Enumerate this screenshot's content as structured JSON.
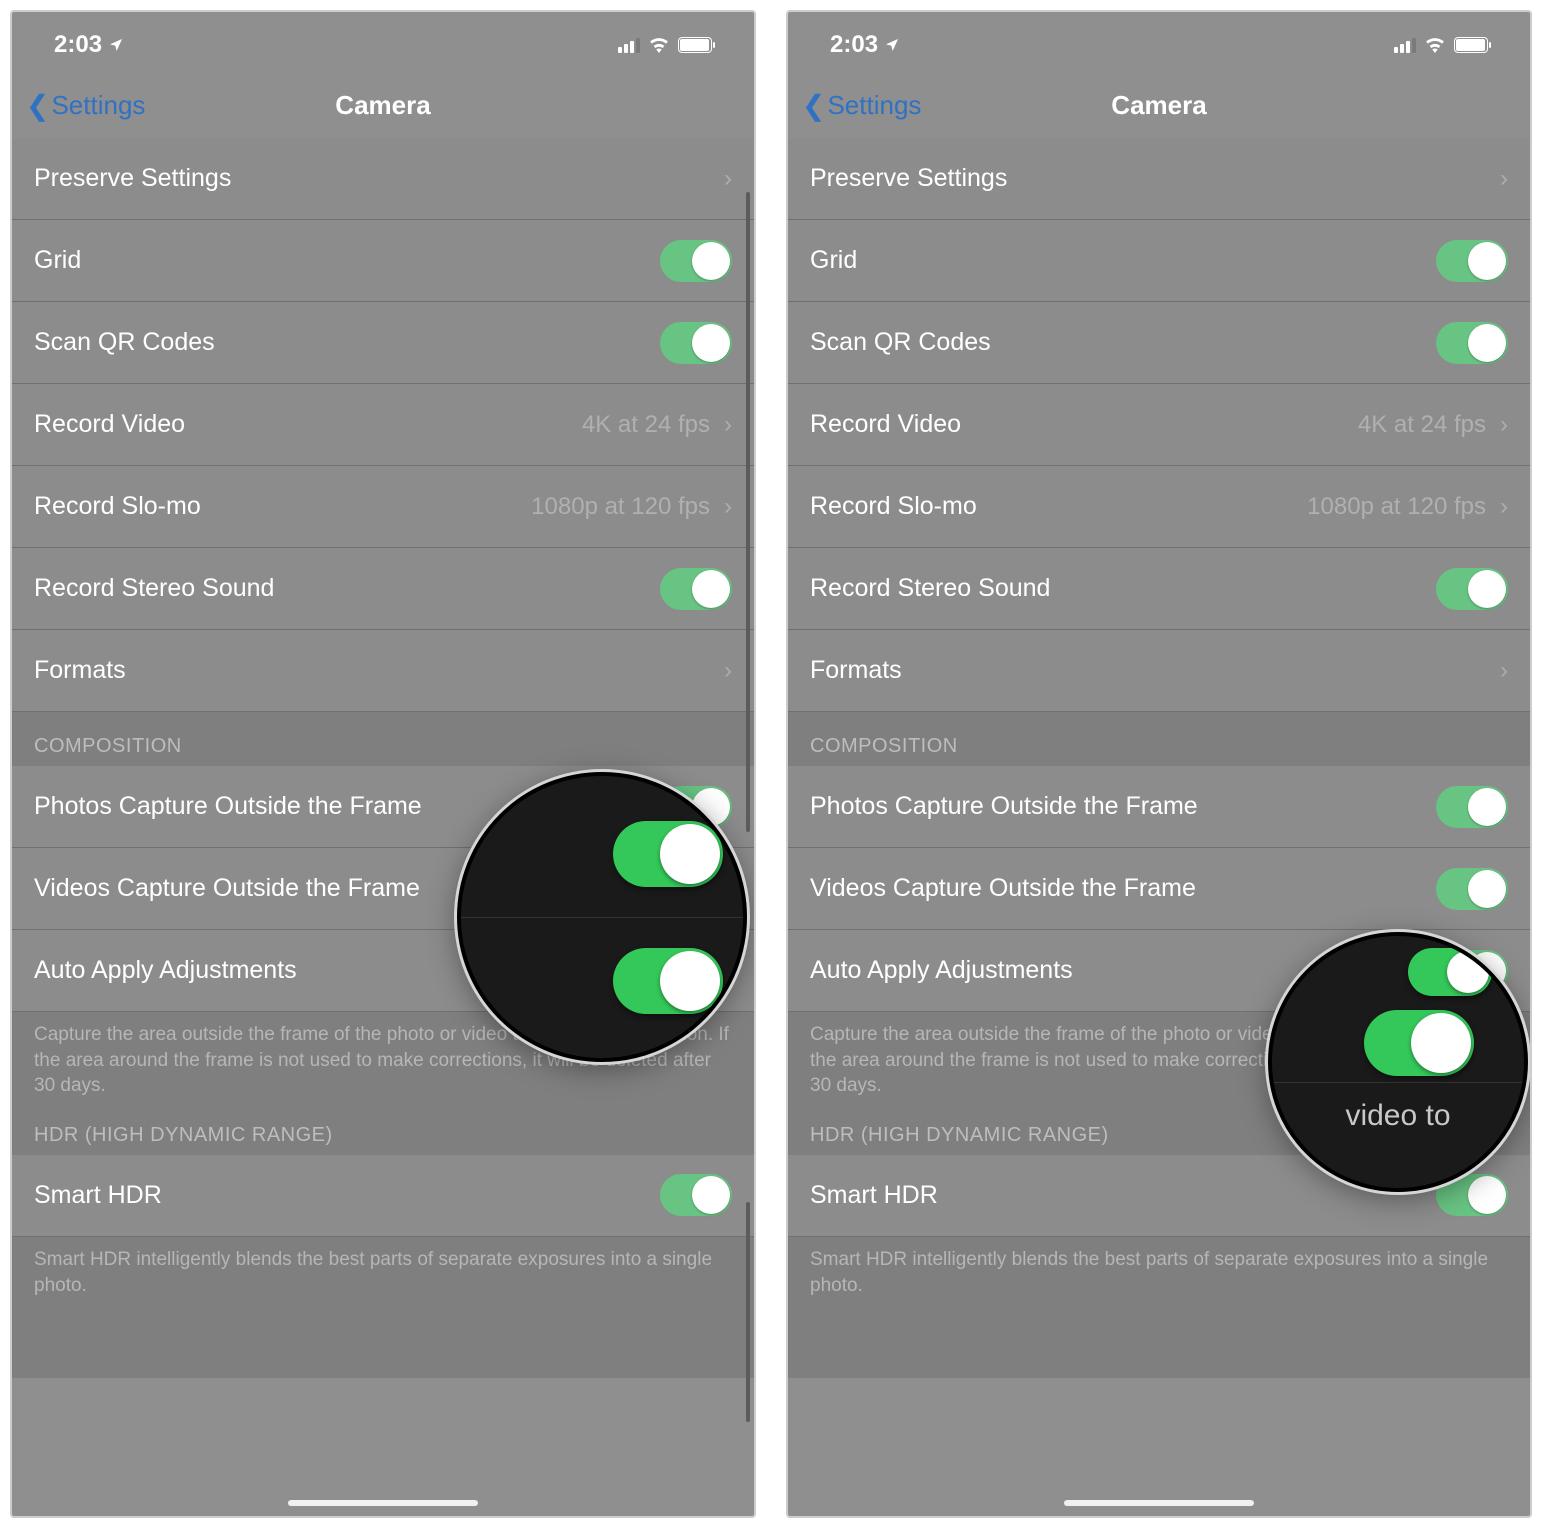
{
  "status": {
    "time": "2:03"
  },
  "nav": {
    "back": "Settings",
    "title": "Camera"
  },
  "rows": {
    "preserve": "Preserve Settings",
    "grid": "Grid",
    "qr": "Scan QR Codes",
    "record_video": "Record Video",
    "record_video_val": "4K at 24 fps",
    "record_slomo": "Record Slo-mo",
    "record_slomo_val": "1080p at 120 fps",
    "stereo": "Record Stereo Sound",
    "formats": "Formats",
    "photos_outside": "Photos Capture Outside the Frame",
    "videos_outside": "Videos Capture Outside the Frame",
    "auto_apply": "Auto Apply Adjustments",
    "smart_hdr": "Smart HDR"
  },
  "headers": {
    "composition": "COMPOSITION",
    "hdr": "HDR (HIGH DYNAMIC RANGE)"
  },
  "footers": {
    "composition": "Capture the area outside the frame of the photo or video to improve composition. If the area around the frame is not used to make corrections, it will be deleted after 30 days.",
    "hdr": "Smart HDR intelligently blends the best parts of separate exposures into a single photo."
  },
  "mag2_text": "video to"
}
